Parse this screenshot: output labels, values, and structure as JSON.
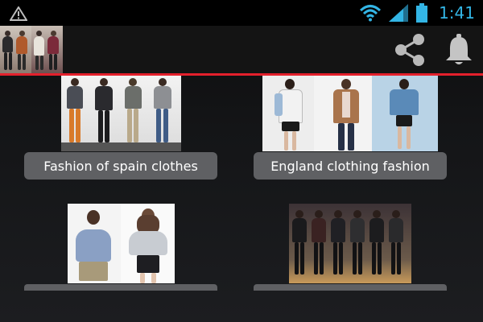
{
  "status_bar": {
    "time": "1:41",
    "icons": [
      "warning-icon",
      "wifi-icon",
      "signal-icon",
      "battery-icon"
    ]
  },
  "action_bar": {
    "app_icon": "app-logo-icon",
    "actions": [
      "share-icon",
      "bell-icon"
    ]
  },
  "grid": {
    "items": [
      {
        "caption": "Fashion of spain clothes"
      },
      {
        "caption": "England clothing fashion"
      },
      {
        "caption": ""
      },
      {
        "caption": ""
      }
    ]
  },
  "colors": {
    "accent_line": "#e4202c",
    "status_time": "#33b5e5",
    "caption_bg": "#5f6063"
  }
}
